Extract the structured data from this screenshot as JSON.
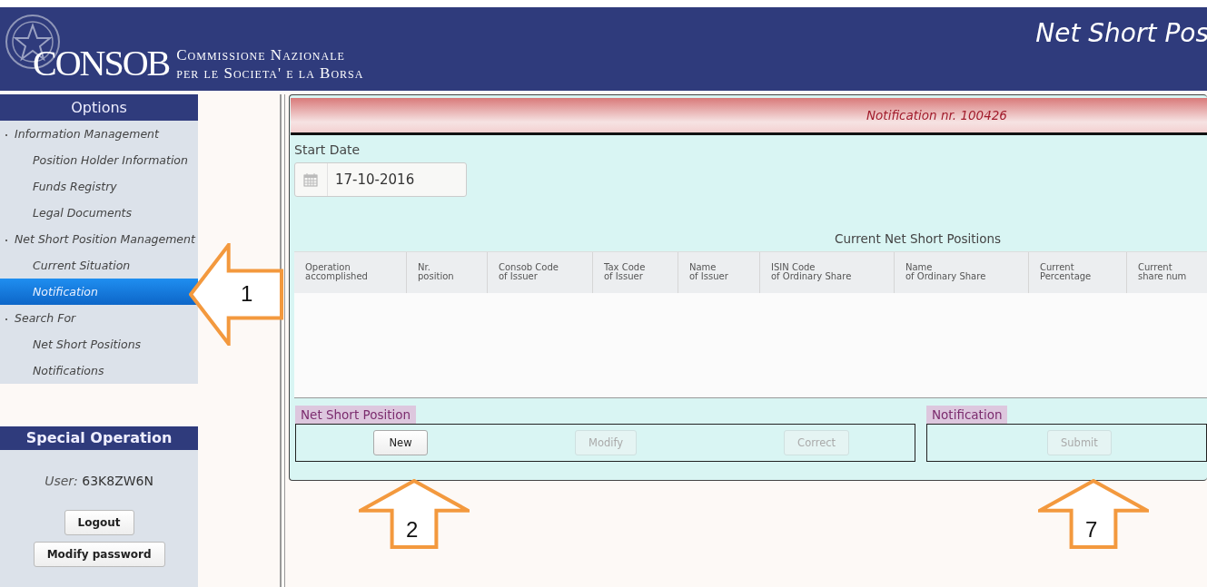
{
  "header": {
    "logo_main": "CONSOB",
    "logo_line_1": "Commissione Nazionale",
    "logo_line_2": "per le Societa' e la Borsa",
    "title": "Net Short Pos"
  },
  "sidebar": {
    "title": "Options",
    "items": [
      {
        "label": "Information Management",
        "selected": false,
        "children": [
          {
            "label": "Position Holder Information",
            "selected": false
          },
          {
            "label": "Funds Registry",
            "selected": false
          },
          {
            "label": "Legal Documents",
            "selected": false
          }
        ]
      },
      {
        "label": "Net Short Position Management",
        "selected": false,
        "children": [
          {
            "label": "Current Situation",
            "selected": false
          },
          {
            "label": "Notification",
            "selected": true
          }
        ]
      },
      {
        "label": "Search For",
        "selected": false,
        "children": [
          {
            "label": "Net Short Positions",
            "selected": false
          },
          {
            "label": "Notifications",
            "selected": false
          }
        ]
      }
    ]
  },
  "special_operation": {
    "title": "Special Operation",
    "user_label": "User:",
    "user_value": "63K8ZW6N",
    "buttons": [
      {
        "label": "Logout"
      },
      {
        "label": "Modify password"
      }
    ]
  },
  "panel": {
    "notification_title": "Notification nr. 100426",
    "start_date": {
      "label": "Start Date",
      "value": "17-10-2016"
    },
    "table": {
      "title": "Current Net Short Positions",
      "columns": [
        {
          "line_1": "Operation",
          "line_2": "accomplished"
        },
        {
          "line_1": "Nr.",
          "line_2": "position"
        },
        {
          "line_1": "Consob Code",
          "line_2": "of Issuer"
        },
        {
          "line_1": "Tax Code",
          "line_2": "of Issuer"
        },
        {
          "line_1": "Name",
          "line_2": "of Issuer"
        },
        {
          "line_1": "ISIN Code",
          "line_2": "of Ordinary Share"
        },
        {
          "line_1": "Name",
          "line_2": "of Ordinary Share"
        },
        {
          "line_1": "Current",
          "line_2": "Percentage"
        },
        {
          "line_1": "Current",
          "line_2": "share num"
        }
      ]
    },
    "sections": [
      {
        "title": "Net Short Position",
        "buttons": [
          {
            "label": "New",
            "disabled": false
          },
          {
            "label": "Modify",
            "disabled": true
          },
          {
            "label": "Correct",
            "disabled": true
          }
        ]
      },
      {
        "title": "Notification",
        "buttons": [
          {
            "label": "Submit",
            "disabled": true
          }
        ]
      }
    ]
  },
  "callouts": [
    {
      "number": "1",
      "kind": "left"
    },
    {
      "number": "2",
      "kind": "up"
    },
    {
      "number": "7",
      "kind": "up"
    }
  ]
}
